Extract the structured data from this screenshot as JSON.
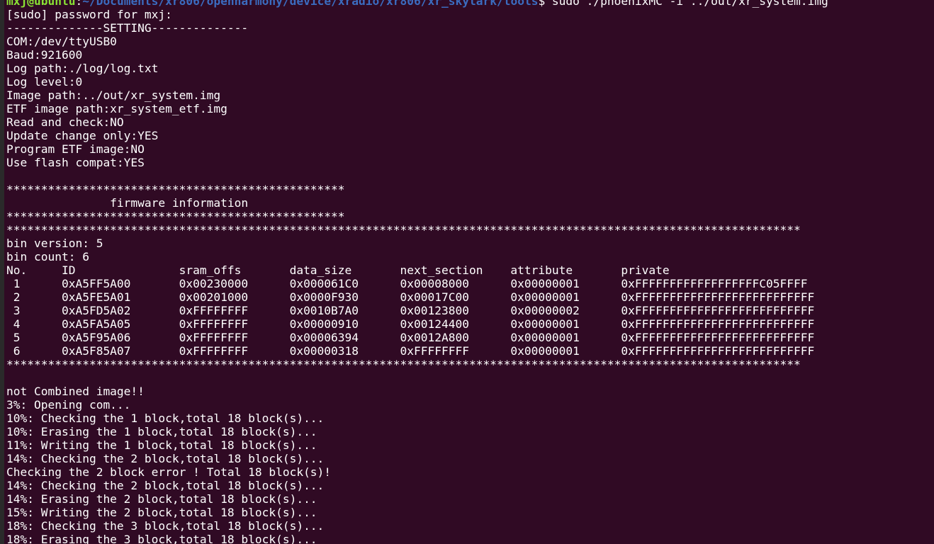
{
  "prompt": {
    "user_host": "mxj@ubuntu",
    "separator": ":",
    "path": "~/Documents/xr806/openharmony/device/xradio/xr806/xr_skylark/tools",
    "command": "$ sudo ./phoenixMC -i ../out/xr_system.img"
  },
  "output_lines": [
    "[sudo] password for mxj:",
    "--------------SETTING--------------",
    "COM:/dev/ttyUSB0",
    "Baud:921600",
    "Log path:./log/log.txt",
    "Log level:0",
    "Image path:../out/xr_system.img",
    "ETF image path:xr_system_etf.img",
    "Read and check:NO",
    "Update change only:YES",
    "Program ETF image:NO",
    "Use flash compat:YES",
    "",
    "*************************************************",
    "               firmware information",
    "*************************************************",
    "*******************************************************************************************************************",
    "bin version: 5",
    "bin count: 6",
    "No.     ID               sram_offs       data_size       next_section    attribute       private",
    " 1      0xA5FF5A00       0x00230000      0x000061C0      0x00008000      0x00000001      0xFFFFFFFFFFFFFFFFFFC05FFFF",
    " 2      0xA5FE5A01       0x00201000      0x0000F930      0x00017C00      0x00000001      0xFFFFFFFFFFFFFFFFFFFFFFFFFF",
    " 3      0xA5FD5A02       0xFFFFFFFF      0x0010B7A0      0x00123800      0x00000002      0xFFFFFFFFFFFFFFFFFFFFFFFFFF",
    " 4      0xA5FA5A05       0xFFFFFFFF      0x00000910      0x00124400      0x00000001      0xFFFFFFFFFFFFFFFFFFFFFFFFFF",
    " 5      0xA5F95A06       0xFFFFFFFF      0x00006394      0x0012A800      0x00000001      0xFFFFFFFFFFFFFFFFFFFFFFFFFF",
    " 6      0xA5F85A07       0xFFFFFFFF      0x00000318      0xFFFFFFFF      0x00000001      0xFFFFFFFFFFFFFFFFFFFFFFFFFF",
    "*******************************************************************************************************************",
    "",
    "not Combined image!!",
    "3%: Opening com...",
    "10%: Checking the 1 block,total 18 block(s)...",
    "10%: Erasing the 1 block,total 18 block(s)...",
    "11%: Writing the 1 block,total 18 block(s)...",
    "14%: Checking the 2 block,total 18 block(s)...",
    "Checking the 2 block error ! Total 18 block(s)!",
    "14%: Checking the 2 block,total 18 block(s)...",
    "14%: Erasing the 2 block,total 18 block(s)...",
    "15%: Writing the 2 block,total 18 block(s)...",
    "18%: Checking the 3 block,total 18 block(s)...",
    "18%: Erasing the 3 block,total 18 block(s)..."
  ]
}
